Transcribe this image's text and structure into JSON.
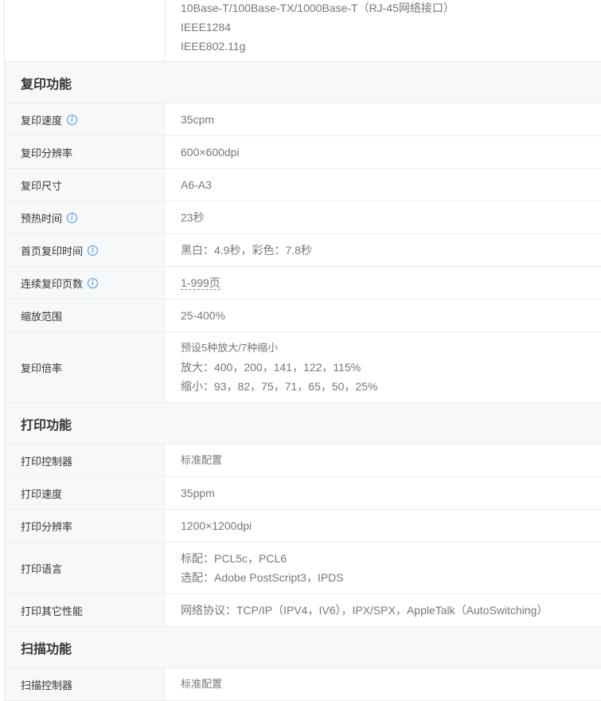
{
  "interfaces": {
    "lines": [
      "10Base-T/100Base-TX/1000Base-T（RJ-45网络接口）",
      "IEEE1284",
      "IEEE802.11g"
    ]
  },
  "copy": {
    "section_title": "复印功能",
    "rows": [
      {
        "label": "复印速度",
        "value": "35cpm"
      },
      {
        "label": "复印分辨率",
        "value": "600×600dpi"
      },
      {
        "label": "复印尺寸",
        "value": "A6-A3"
      },
      {
        "label": "预热时间",
        "value": "23秒"
      },
      {
        "label": "首页复印时间",
        "value": "黑白：4.9秒，彩色：7.8秒"
      },
      {
        "label": "连续复印页数",
        "value": "1-999页"
      },
      {
        "label": "缩放范围",
        "value": "25-400%"
      },
      {
        "label": "复印倍率",
        "lines": [
          "预设5种放大/7种缩小",
          "放大：400，200，141，122，115%",
          "缩小：93，82，75，71，65，50，25%"
        ]
      }
    ]
  },
  "print": {
    "section_title": "打印功能",
    "rows": [
      {
        "label": "打印控制器",
        "value": "标准配置"
      },
      {
        "label": "打印速度",
        "value": "35ppm"
      },
      {
        "label": "打印分辨率",
        "value": "1200×1200dpi"
      },
      {
        "label": "打印语言",
        "lines": [
          "标配：PCL5c，PCL6",
          "选配：Adobe PostScript3，IPDS"
        ]
      },
      {
        "label": "打印其它性能",
        "value": "网络协议：TCP/IP（IPV4，IV6），IPX/SPX，AppleTalk（AutoSwitching）"
      }
    ]
  },
  "scan": {
    "section_title": "扫描功能",
    "rows": [
      {
        "label": "扫描控制器",
        "value": "标准配置"
      }
    ]
  }
}
